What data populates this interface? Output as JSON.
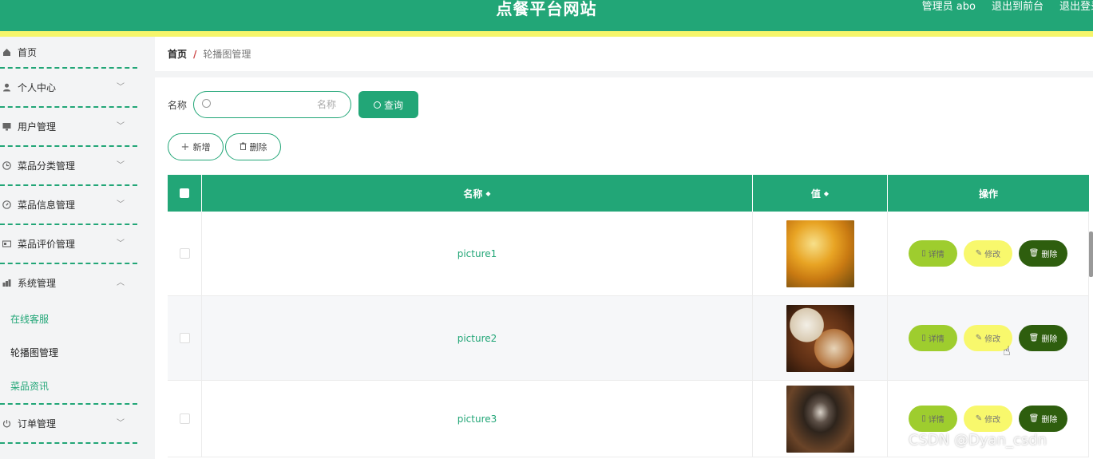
{
  "header": {
    "title": "点餐平台网站",
    "user": "管理员 abo",
    "link_front": "退出到前台",
    "link_logout": "退出登录"
  },
  "sidebar": {
    "items": [
      {
        "label": "首页",
        "icon": "home-icon"
      },
      {
        "label": "个人中心",
        "icon": "user-icon"
      },
      {
        "label": "用户管理",
        "icon": "monitor-icon"
      },
      {
        "label": "菜品分类管理",
        "icon": "clock-icon"
      },
      {
        "label": "菜品信息管理",
        "icon": "compass-icon"
      },
      {
        "label": "菜品评价管理",
        "icon": "card-icon"
      },
      {
        "label": "系统管理",
        "icon": "chart-icon"
      },
      {
        "label": "订单管理",
        "icon": "power-icon"
      }
    ],
    "sub_items": [
      "在线客服",
      "轮播图管理",
      "菜品资讯"
    ]
  },
  "breadcrumb": {
    "home": "首页",
    "sep": "/",
    "current": "轮播图管理"
  },
  "search": {
    "label": "名称",
    "placeholder": "名称",
    "button": "查询"
  },
  "actions": {
    "add": "新增",
    "delete": "删除"
  },
  "table": {
    "headers": {
      "name": "名称",
      "value": "值",
      "ops": "操作"
    },
    "rows": [
      {
        "name": "picture1"
      },
      {
        "name": "picture2"
      },
      {
        "name": "picture3"
      }
    ],
    "op_labels": {
      "detail": "详情",
      "edit": "修改",
      "delete": "删除"
    }
  },
  "watermark": "CSDN @Dyan_csdn",
  "colors": {
    "primary": "#22a677",
    "accent_yellow": "#f5f56a",
    "detail": "#9ecd2e",
    "edit": "#f8f86c",
    "danger": "#2e5e0e"
  }
}
